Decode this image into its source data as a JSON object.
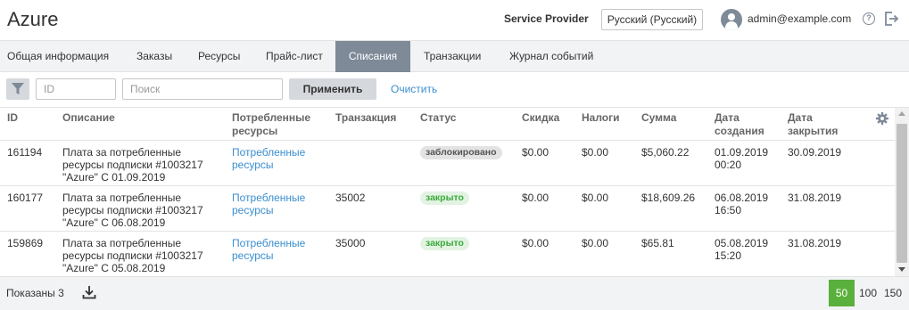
{
  "header": {
    "app_title": "Azure",
    "provider": "Service Provider",
    "language": "Русский (Русский)",
    "user_email": "admin@example.com",
    "help_symbol": "?"
  },
  "tabs": [
    {
      "label": "Общая информация",
      "active": false
    },
    {
      "label": "Заказы",
      "active": false
    },
    {
      "label": "Ресурсы",
      "active": false
    },
    {
      "label": "Прайс-лист",
      "active": false
    },
    {
      "label": "Списания",
      "active": true
    },
    {
      "label": "Транзакции",
      "active": false
    },
    {
      "label": "Журнал событий",
      "active": false
    }
  ],
  "filter": {
    "id_placeholder": "ID",
    "search_placeholder": "Поиск",
    "apply_label": "Применить",
    "clear_label": "Очистить"
  },
  "table": {
    "columns": {
      "id": "ID",
      "description": "Описание",
      "consumed_1": "Потребленные",
      "consumed_2": "ресурсы",
      "transaction": "Транзакция",
      "status": "Статус",
      "discount": "Скидка",
      "taxes": "Налоги",
      "amount": "Сумма",
      "created_1": "Дата",
      "created_2": "создания",
      "closed_1": "Дата",
      "closed_2": "закрытия"
    },
    "rows": [
      {
        "id": "161194",
        "desc_1": "Плата за потребленные",
        "desc_2": "ресурсы подписки #1003217",
        "desc_3": "\"Azure\" С 01.09.2019",
        "consumed_1": "Потребленные",
        "consumed_2": "ресурсы",
        "transaction": "",
        "status": "заблокировано",
        "discount": "$0.00",
        "taxes": "$0.00",
        "amount": "$5,060.22",
        "created_date": "01.09.2019",
        "created_time": "00:20",
        "closed": "30.09.2019"
      },
      {
        "id": "160177",
        "desc_1": "Плата за потребленные",
        "desc_2": "ресурсы подписки #1003217",
        "desc_3": "\"Azure\" С 06.08.2019",
        "consumed_1": "Потребленные",
        "consumed_2": "ресурсы",
        "transaction": "35002",
        "status": "закрыто",
        "discount": "$0.00",
        "taxes": "$0.00",
        "amount": "$18,609.26",
        "created_date": "06.08.2019",
        "created_time": "16:50",
        "closed": "31.08.2019"
      },
      {
        "id": "159869",
        "desc_1": "Плата за потребленные",
        "desc_2": "ресурсы подписки #1003217",
        "desc_3": "\"Azure\" С 05.08.2019",
        "consumed_1": "Потребленные",
        "consumed_2": "ресурсы",
        "transaction": "35000",
        "status": "закрыто",
        "discount": "$0.00",
        "taxes": "$0.00",
        "amount": "$65.81",
        "created_date": "05.08.2019",
        "created_time": "15:20",
        "closed": "31.08.2019"
      }
    ]
  },
  "footer": {
    "shown": "Показаны 3",
    "page_sizes": [
      "50",
      "100",
      "150"
    ],
    "active_page_size": "50"
  },
  "colors": {
    "active_tab": "#7e8a98",
    "link": "#3a8ed0",
    "page_size_active": "#5ab03c",
    "status_closed": "#3caa3c"
  }
}
